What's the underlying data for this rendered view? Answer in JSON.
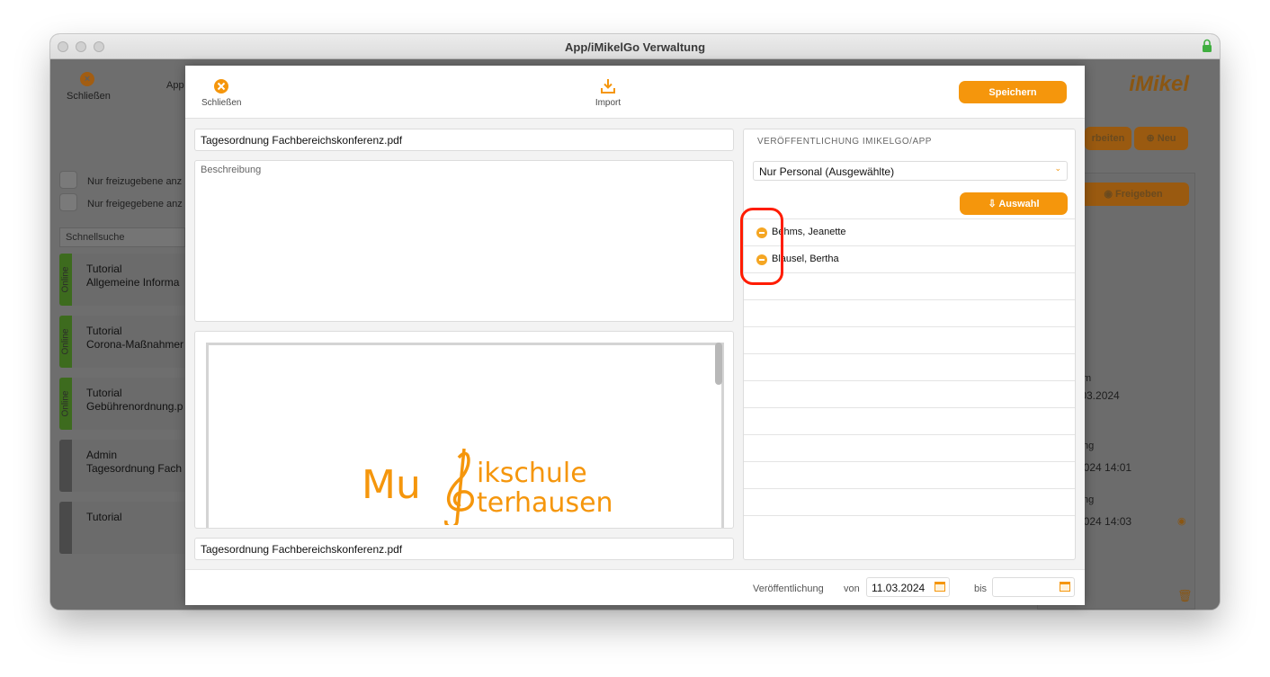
{
  "window": {
    "title": "App/iMikelGo Verwaltung"
  },
  "background": {
    "close_label": "Schließen",
    "apps_label": "App",
    "logo": "iMikel",
    "bearbeiten_label": "rbeiten",
    "neu_label": "Neu",
    "freigeben_label": "Freigeben",
    "filter_unreleased": "Nur freizugebene anz",
    "filter_released": "Nur freigegebene anz",
    "search_placeholder": "Schnellsuche",
    "items": [
      {
        "tag": "Online",
        "line1": "Tutorial",
        "line2": "Allgemeine Informa"
      },
      {
        "tag": "Online",
        "line1": "Tutorial",
        "line2": "Corona-Maßnahmer"
      },
      {
        "tag": "Online",
        "line1": "Tutorial",
        "line2": "Gebührenordnung.p"
      },
      {
        "tag": "",
        "line1": "Admin",
        "line2": "Tagesordnung Fach"
      },
      {
        "tag": "",
        "line1": "Tutorial",
        "line2": ""
      }
    ],
    "side_texts": [
      "m",
      ".03.2024",
      "ng",
      "2024 14:01",
      "ng",
      "2024 14:03"
    ]
  },
  "modal": {
    "toolbar": {
      "close_label": "Schließen",
      "import_label": "Import",
      "save_label": "Speichern"
    },
    "title_value": "Tagesordnung Fachbereichskonferenz.pdf",
    "description_placeholder": "Beschreibung",
    "preview_logo": {
      "line1": "Mu",
      "line1b": "ikschule",
      "line2": "terhausen"
    },
    "filename_value": "Tagesordnung Fachbereichskonferenz.pdf",
    "publication": {
      "section_title": "VERÖFFENTLICHUNG IMIKELGO/APP",
      "audience": "Nur Personal (Ausgewählte)",
      "select_button": "Auswahl",
      "people": [
        "Behms, Jeanette",
        "Blausel, Bertha"
      ]
    },
    "footer": {
      "publication_label": "Veröffentlichung",
      "from_label": "von",
      "from_value": "11.03.2024",
      "to_label": "bis",
      "to_value": ""
    }
  },
  "colors": {
    "accent": "#f5960c",
    "highlight": "#ff1c00"
  }
}
